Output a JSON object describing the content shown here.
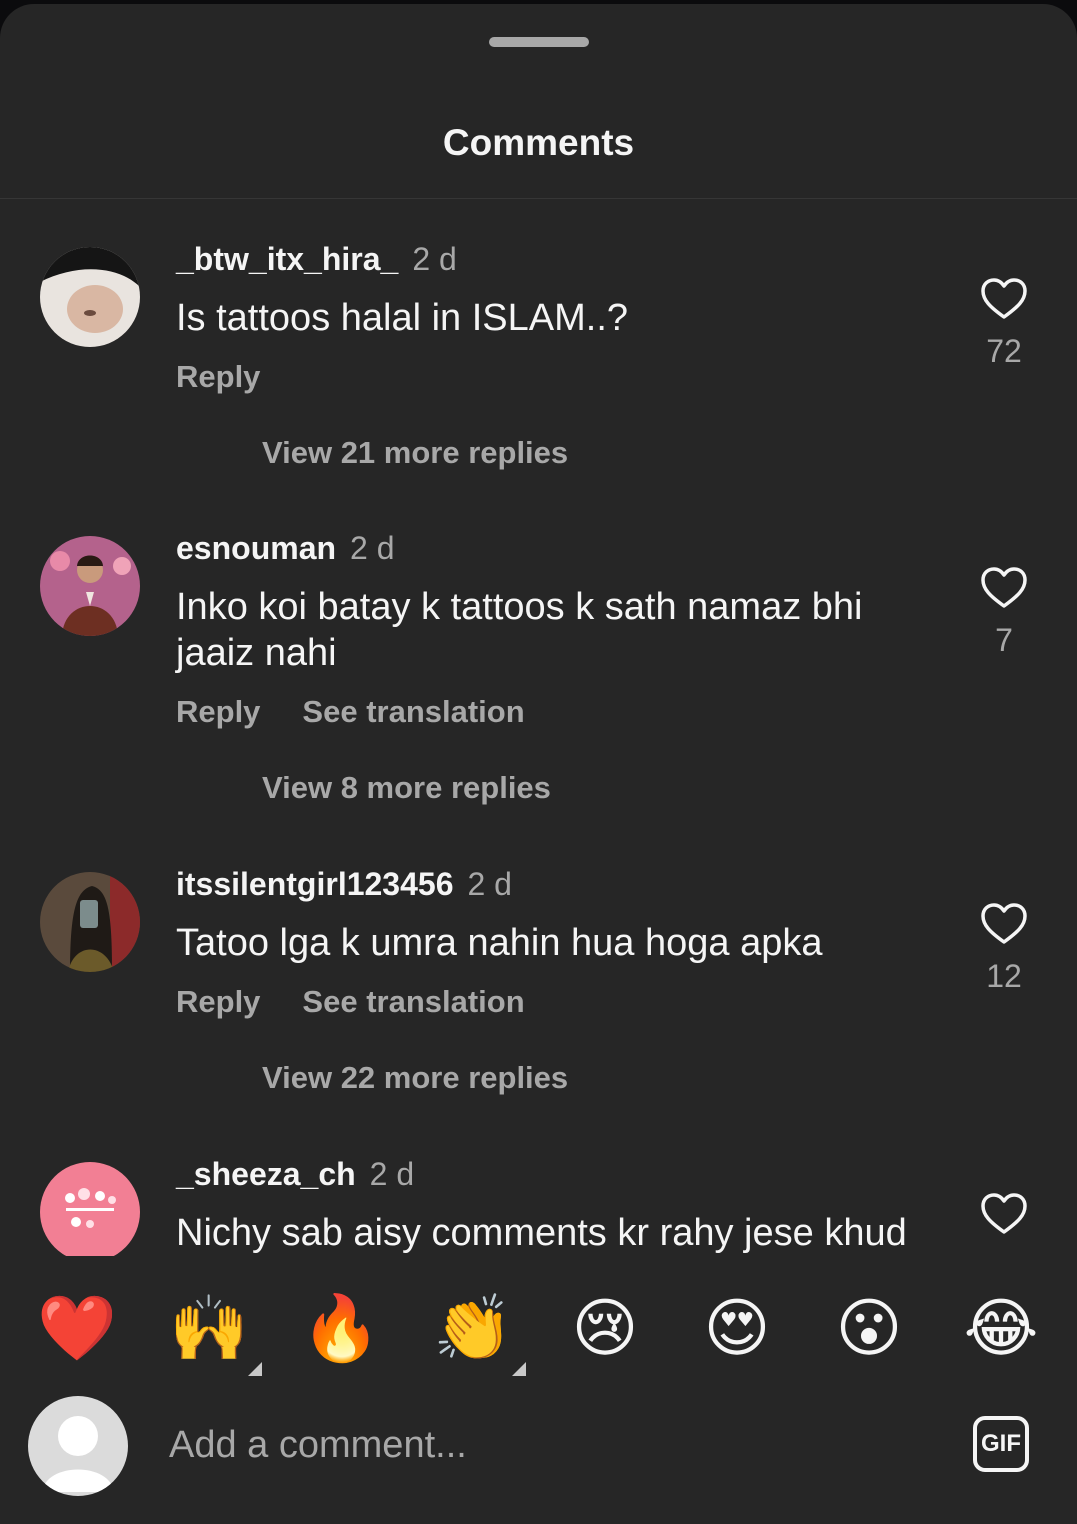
{
  "header": {
    "title": "Comments"
  },
  "comments": [
    {
      "username": "_btw_itx_hira_",
      "time": "2 d",
      "text": "Is tattoos halal in ISLAM..?",
      "actions": [
        "Reply"
      ],
      "likes": "72",
      "view_replies": "View 21 more replies"
    },
    {
      "username": "esnouman",
      "time": "2 d",
      "text": "Inko koi batay k tattoos k sath namaz bhi jaaiz nahi",
      "actions": [
        "Reply",
        "See translation"
      ],
      "likes": "7",
      "view_replies": "View 8 more replies"
    },
    {
      "username": "itssilentgirl123456",
      "time": "2 d",
      "text": "Tatoo lga k umra nahin hua hoga apka",
      "actions": [
        "Reply",
        "See translation"
      ],
      "likes": "12",
      "view_replies": "View 22 more replies"
    },
    {
      "username": "_sheeza_ch",
      "time": "2 d",
      "text": "Nichy sab aisy comments kr rahy jese khud"
    }
  ],
  "quick_reactions": [
    "❤️",
    "🙌",
    "🔥",
    "👏",
    "😢",
    "😍",
    "😮",
    "😂"
  ],
  "composer": {
    "placeholder": "Add a comment...",
    "gif_label": "GIF"
  },
  "colors": {
    "sheet_background": "#262626",
    "primary_text": "#f5f5f5",
    "secondary_text": "#a8a8a8"
  }
}
